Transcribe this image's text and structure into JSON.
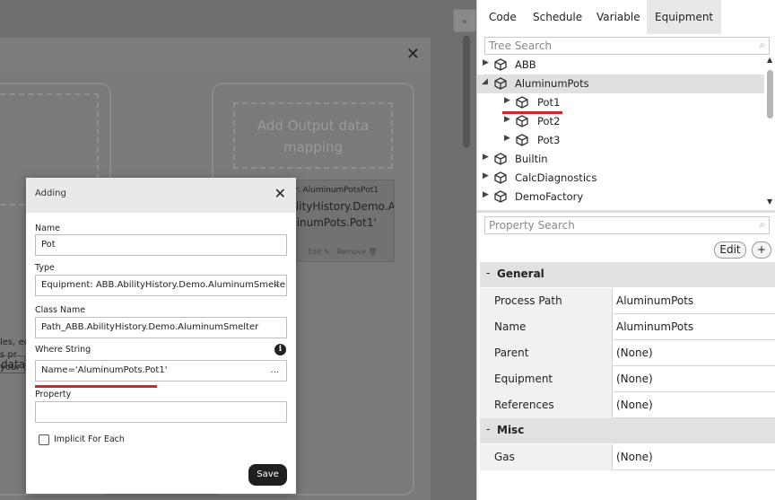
{
  "background": {
    "output_mapping": "Add Output data mapping",
    "mapping_card": {
      "line1": "ter: AluminumPotsPot1",
      "line2": "bilityHistory.Demo.A",
      "line3": "minumPots.Pot1'",
      "edit": "Edit",
      "remove": "Remove"
    },
    "text_lines": [
      "les, ec",
      "s pr",
      "your c"
    ],
    "data_button": "data"
  },
  "dialog": {
    "title": "Adding",
    "name_label": "Name",
    "name_value": "Pot",
    "type_label": "Type",
    "type_value": "Equipment: ABB.AbilityHistory.Demo.AluminumSmelter",
    "class_label": "Class Name",
    "class_value": "Path_ABB.AbilityHistory.Demo.AluminumSmelter",
    "where_label": "Where String",
    "where_value": "Name='AluminumPots.Pot1'",
    "where_more": "...",
    "property_label": "Property",
    "property_value": "",
    "implicit_label": "Implicit For Each",
    "implicit_checked": false,
    "save_label": "Save",
    "info_glyph": "i"
  },
  "tabs": [
    {
      "label": "Code"
    },
    {
      "label": "Schedule"
    },
    {
      "label": "Variable"
    },
    {
      "label": "Equipment",
      "active": true
    }
  ],
  "tree_search_placeholder": "Tree Search",
  "property_search_placeholder": "Property Search",
  "tree": [
    {
      "label": "ABB",
      "expanded": false
    },
    {
      "label": "AluminumPots",
      "expanded": true,
      "selected": true
    },
    {
      "label": "Pot1",
      "expanded": false
    },
    {
      "label": "Pot2",
      "expanded": false
    },
    {
      "label": "Pot3",
      "expanded": false
    },
    {
      "label": "Builtin",
      "expanded": false
    },
    {
      "label": "CalcDiagnostics",
      "expanded": false
    },
    {
      "label": "DemoFactory",
      "expanded": false
    }
  ],
  "edit_label": "Edit",
  "add_label": "+",
  "property_groups": [
    {
      "name": "General",
      "rows": [
        {
          "key": "Process Path",
          "value": "AluminumPots"
        },
        {
          "key": "Name",
          "value": "AluminumPots"
        },
        {
          "key": "Parent",
          "value": "(None)"
        },
        {
          "key": "Equipment",
          "value": "(None)"
        },
        {
          "key": "References",
          "value": "(None)"
        }
      ]
    },
    {
      "name": "Misc",
      "rows": [
        {
          "key": "Gas",
          "value": "(None)"
        }
      ]
    }
  ],
  "colors": {
    "highlight_underline": "#d9232a",
    "overlay": "#6f6f6f",
    "save_button": "#1f1f1f"
  }
}
